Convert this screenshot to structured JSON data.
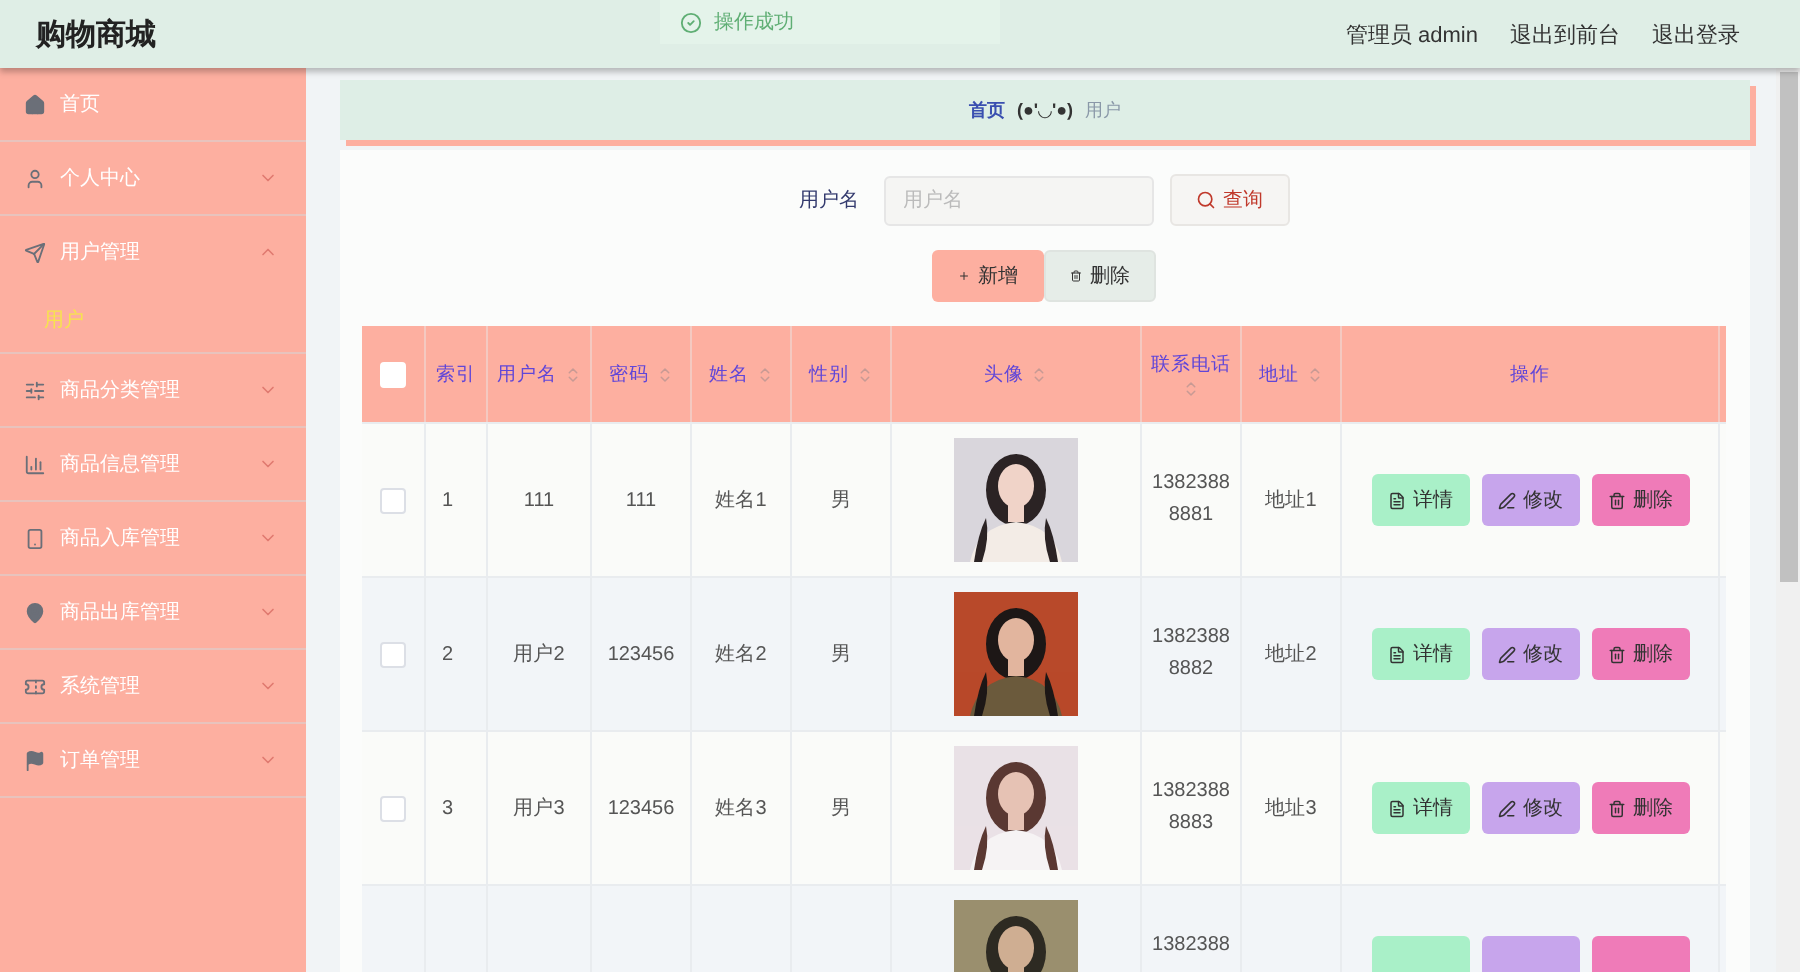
{
  "header": {
    "title": "购物商城",
    "toast": "操作成功",
    "links": [
      {
        "label": "管理员 admin"
      },
      {
        "label": "退出到前台"
      },
      {
        "label": "退出登录"
      }
    ]
  },
  "sidebar": {
    "items": [
      {
        "label": "首页",
        "kind": "link"
      },
      {
        "label": "个人中心",
        "kind": "menu",
        "expanded": false
      },
      {
        "label": "用户管理",
        "kind": "menu",
        "expanded": true,
        "children": [
          {
            "label": "用户",
            "selected": true
          }
        ]
      },
      {
        "label": "商品分类管理",
        "kind": "menu",
        "expanded": false
      },
      {
        "label": "商品信息管理",
        "kind": "menu",
        "expanded": false
      },
      {
        "label": "商品入库管理",
        "kind": "menu",
        "expanded": false
      },
      {
        "label": "商品出库管理",
        "kind": "menu",
        "expanded": false
      },
      {
        "label": "系统管理",
        "kind": "menu",
        "expanded": false
      },
      {
        "label": "订单管理",
        "kind": "menu",
        "expanded": false
      }
    ]
  },
  "breadcrumb": {
    "home": "首页",
    "separator": "(●'◡'●)",
    "current": "用户"
  },
  "search": {
    "label": "用户名",
    "placeholder": "用户名",
    "button": "查询"
  },
  "actions": [
    {
      "label": "新增",
      "kind": "add"
    },
    {
      "label": "删除",
      "kind": "delete"
    }
  ],
  "table": {
    "select_all": {
      "checked": false
    },
    "columns": [
      {
        "label": "索引",
        "sortable": false
      },
      {
        "label": "用户名",
        "sortable": true
      },
      {
        "label": "密码",
        "sortable": true
      },
      {
        "label": "姓名",
        "sortable": true
      },
      {
        "label": "性别",
        "sortable": true
      },
      {
        "label": "头像",
        "sortable": true
      },
      {
        "label": "联系电话",
        "sortable": true
      },
      {
        "label": "地址",
        "sortable": true
      },
      {
        "label": "操作",
        "sortable": false
      }
    ],
    "rows": [
      {
        "checked": false,
        "index": "1",
        "username": "111",
        "password": "111",
        "name": "姓名1",
        "gender": "男",
        "avatar": {
          "kind": "picture"
        },
        "phone": "13823888881",
        "address": "地址1",
        "actions": [
          {
            "label": "详情",
            "kind": "detail"
          },
          {
            "label": "修改",
            "kind": "edit"
          },
          {
            "label": "删除",
            "kind": "delete"
          }
        ]
      },
      {
        "checked": false,
        "index": "2",
        "username": "用户2",
        "password": "123456",
        "name": "姓名2",
        "gender": "男",
        "avatar": {
          "kind": "picture"
        },
        "phone": "13823888882",
        "address": "地址2",
        "actions": [
          {
            "label": "详情",
            "kind": "detail"
          },
          {
            "label": "修改",
            "kind": "edit"
          },
          {
            "label": "删除",
            "kind": "delete"
          }
        ]
      },
      {
        "checked": false,
        "index": "3",
        "username": "用户3",
        "password": "123456",
        "name": "姓名3",
        "gender": "男",
        "avatar": {
          "kind": "picture"
        },
        "phone": "13823888883",
        "address": "地址3",
        "actions": [
          {
            "label": "详情",
            "kind": "detail"
          },
          {
            "label": "修改",
            "kind": "edit"
          },
          {
            "label": "删除",
            "kind": "delete"
          }
        ]
      },
      {
        "avatar": {
          "kind": "picture"
        },
        "phone": "1382388",
        "actions": [
          {
            "kind": "detail"
          },
          {
            "kind": "edit"
          },
          {
            "kind": "delete"
          }
        ]
      }
    ]
  }
}
